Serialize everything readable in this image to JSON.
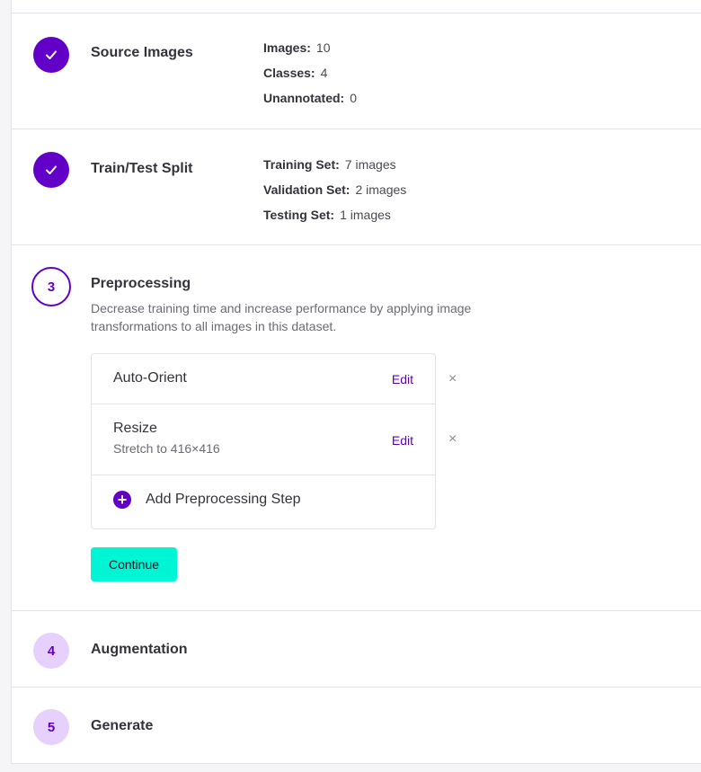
{
  "steps": {
    "source": {
      "title": "Source Images",
      "stats": [
        {
          "label": "Images:",
          "value": "10"
        },
        {
          "label": "Classes:",
          "value": "4"
        },
        {
          "label": "Unannotated:",
          "value": "0"
        }
      ]
    },
    "split": {
      "title": "Train/Test Split",
      "stats": [
        {
          "label": "Training Set:",
          "value": "7 images"
        },
        {
          "label": "Validation Set:",
          "value": "2 images"
        },
        {
          "label": "Testing Set:",
          "value": "1 images"
        }
      ]
    },
    "preprocessing": {
      "number": "3",
      "title": "Preprocessing",
      "description": "Decrease training time and increase performance by applying image transformations to all images in this dataset.",
      "items": [
        {
          "name": "Auto-Orient",
          "detail": "",
          "edit_label": "Edit",
          "remove_label": "×"
        },
        {
          "name": "Resize",
          "detail": "Stretch to 416×416",
          "edit_label": "Edit",
          "remove_label": "×"
        }
      ],
      "add_label": "Add Preprocessing Step",
      "continue_label": "Continue"
    },
    "augmentation": {
      "number": "4",
      "title": "Augmentation"
    },
    "generate": {
      "number": "5",
      "title": "Generate"
    }
  },
  "colors": {
    "accent": "#6300c8",
    "pending": "#e5d1fb",
    "continue": "#00f5d4"
  },
  "icons": {
    "completed": "check-icon",
    "remove": "close-icon",
    "add": "plus-icon"
  }
}
